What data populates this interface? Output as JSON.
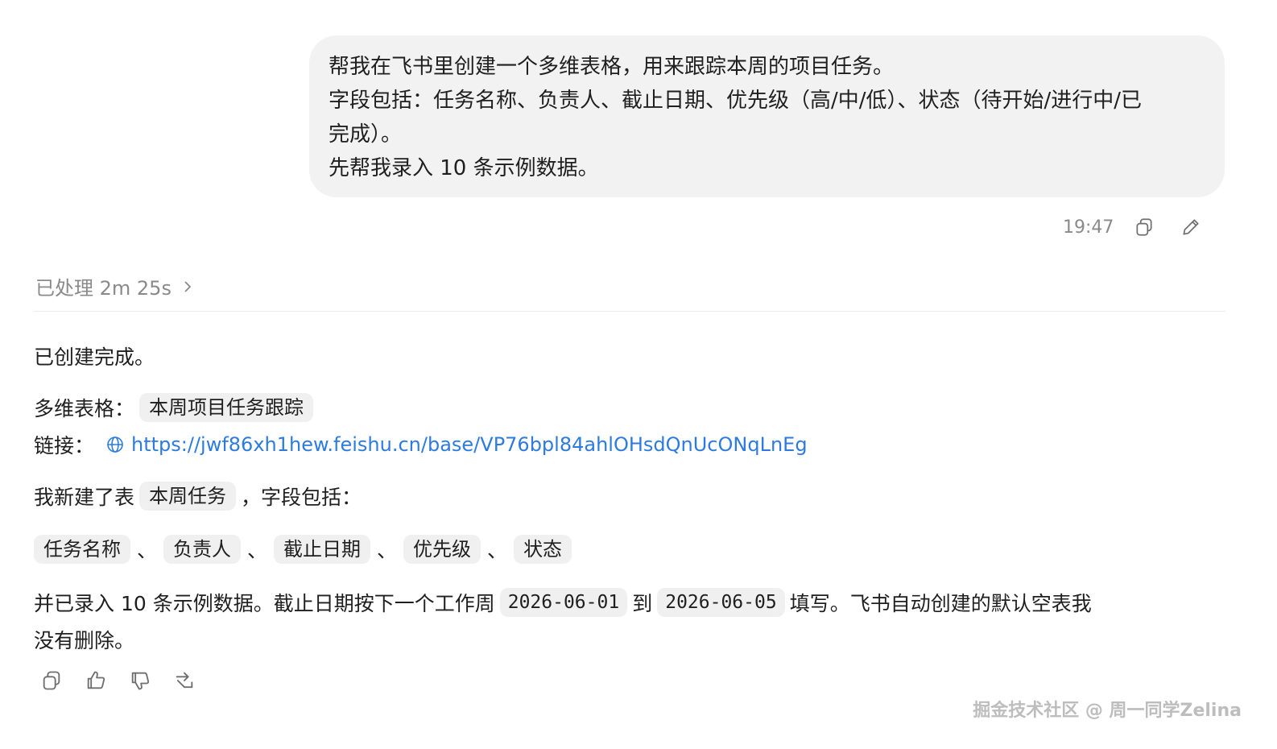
{
  "user_message": {
    "lines": [
      "帮我在飞书里创建一个多维表格，用来跟踪本周的项目任务。",
      "字段包括：任务名称、负责人、截止日期、优先级（高/中/低）、状态（待开始/进行中/已",
      "完成）。",
      "先帮我录入 10 条示例数据。"
    ],
    "time": "19:47"
  },
  "processed": {
    "label": "已处理 2m 25s"
  },
  "reply": {
    "done": "已创建完成。",
    "table_label": "多维表格：",
    "table_name": "本周项目任务跟踪",
    "link_label": "链接：",
    "link_url": "https://jwf86xh1hew.feishu.cn/base/VP76bpl84ahlOHsdQnUcONqLnEg",
    "new_table_prefix": "我新建了表",
    "new_table_name": "本周任务",
    "new_table_suffix": "，字段包括：",
    "fields": [
      "任务名称",
      "负责人",
      "截止日期",
      "优先级",
      "状态"
    ],
    "separator": "、",
    "data_line_1_prefix": "并已录入 10 条示例数据。截止日期按下一个工作周",
    "date_start": "2026-06-01",
    "date_to": "到",
    "date_end": "2026-06-05",
    "data_line_1_suffix": "填写。飞书自动创建的默认空表我",
    "data_line_2": "没有删除。"
  },
  "watermark": "掘金技术社区 @ 周一同学Zelina",
  "icons": {
    "copy": "copy-icon",
    "edit": "pencil-icon",
    "chevron": "chevron-right-icon",
    "globe": "globe-icon",
    "like": "thumbs-up-icon",
    "dislike": "thumbs-down-icon",
    "share": "share-icon"
  },
  "colors": {
    "bubble": "#f2f2f2",
    "link": "#2d7be0",
    "chip": "#f0f0f0",
    "muted": "#8a8a8a"
  }
}
